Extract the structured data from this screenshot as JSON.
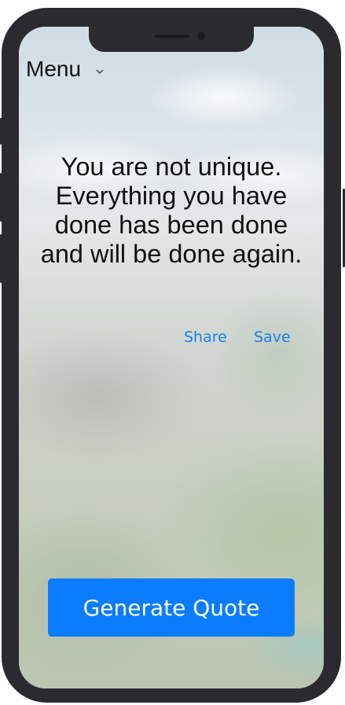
{
  "menu": {
    "label": "Menu",
    "icon": "chevron-down-icon"
  },
  "quote": {
    "text": "You are not unique. Everything you have done has been done and will be done again."
  },
  "actions": {
    "share_label": "Share",
    "save_label": "Save"
  },
  "generate_button": {
    "label": "Generate Quote"
  },
  "colors": {
    "accent": "#0a7cff",
    "link": "#1a7fe8",
    "frame": "#2b2a2f"
  }
}
